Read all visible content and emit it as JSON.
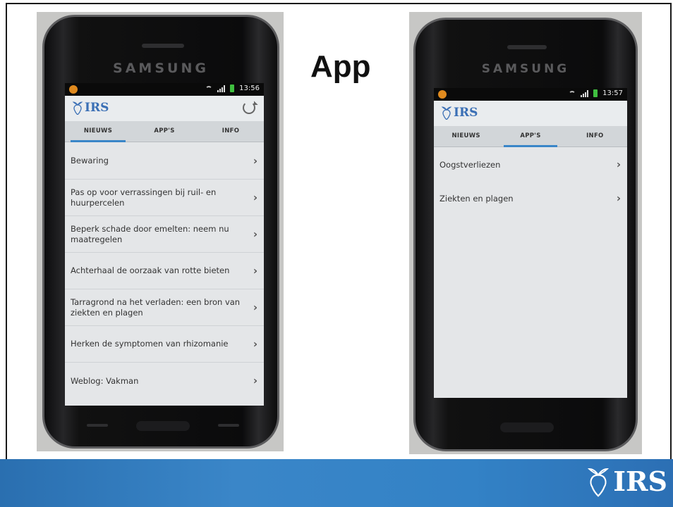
{
  "slide": {
    "title": "App"
  },
  "left_phone": {
    "brand": "SAMSUNG",
    "status_time": "13:56",
    "logo_text": "IRS",
    "tabs": [
      {
        "label": "NIEUWS",
        "active": true
      },
      {
        "label": "APP'S",
        "active": false
      },
      {
        "label": "INFO",
        "active": false
      }
    ],
    "items": [
      "Bewaring",
      "Pas op voor verrassingen bij ruil- en huurpercelen",
      "Beperk schade door emelten: neem nu maatregelen",
      "Achterhaal de oorzaak van rotte bieten",
      "Tarragrond na het verladen: een bron van ziekten en plagen",
      "Herken de symptomen van rhizomanie",
      "Weblog: Vakman"
    ]
  },
  "right_phone": {
    "brand": "SAMSUNG",
    "status_time": "13:57",
    "logo_text": "IRS",
    "tabs": [
      {
        "label": "NIEUWS",
        "active": false
      },
      {
        "label": "APP'S",
        "active": true
      },
      {
        "label": "INFO",
        "active": false
      }
    ],
    "items": [
      "Oogstverliezen",
      "Ziekten en plagen"
    ]
  },
  "footer": {
    "logo_text": "IRS",
    "color": "#3a86c8"
  },
  "icons": [
    "refresh-icon",
    "chevron-right-icon",
    "wifi-icon",
    "signal-icon",
    "battery-icon",
    "beet-logo-icon"
  ]
}
